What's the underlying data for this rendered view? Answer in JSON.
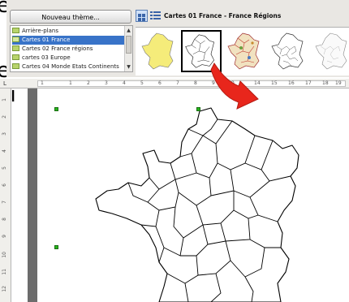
{
  "background_text": [
    "e",
    "e",
    "di",
    "n",
    "n"
  ],
  "gallery": {
    "new_theme_button": "Nouveau thème...",
    "themes": [
      {
        "label": "Arrière-plans",
        "selected": false
      },
      {
        "label": "Cartes 01 France",
        "selected": true
      },
      {
        "label": "Cartes 02 France régions",
        "selected": false
      },
      {
        "label": "cartes 03  Europe",
        "selected": false
      },
      {
        "label": "Cartes 04 Monde Etats Continents",
        "selected": false
      }
    ],
    "current_theme_title": "Cartes 01 France  - France Régions",
    "thumbnails": [
      {
        "name": "france-yellow",
        "selected": false
      },
      {
        "name": "france-regions-outline",
        "selected": true
      },
      {
        "name": "france-regions-colored",
        "selected": false
      },
      {
        "name": "france-departments-outline",
        "selected": false
      },
      {
        "name": "france-departments-light",
        "selected": false
      }
    ]
  },
  "ruler": {
    "corner_label": "L",
    "start_label": "1",
    "ticks": [
      "1",
      "2",
      "3",
      "4",
      "5",
      "6",
      "7",
      "8",
      "9",
      "10",
      "14",
      "15",
      "16",
      "17",
      "18",
      "19"
    ],
    "vertical_ticks": [
      "1",
      "2",
      "3",
      "4",
      "5",
      "6",
      "7",
      "8",
      "9",
      "10",
      "11",
      "12"
    ]
  },
  "colors": {
    "accent_selection": "#3873c8",
    "arrow": "#e8261c",
    "handle": "#27b51c",
    "folder": "#b8d46c"
  },
  "icons": {
    "view_icons": "grid-icon",
    "view_details": "list-icon",
    "drag_arrow": "curved-arrow-icon"
  }
}
